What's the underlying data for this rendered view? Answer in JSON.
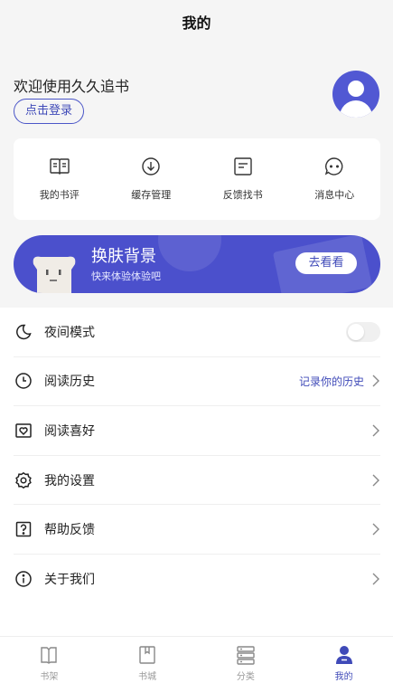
{
  "header": {
    "title": "我的"
  },
  "profile": {
    "welcome": "欢迎使用久久追书",
    "login_label": "点击登录"
  },
  "quick_actions": [
    {
      "label": "我的书评",
      "icon": "book-review-icon"
    },
    {
      "label": "缓存管理",
      "icon": "download-icon"
    },
    {
      "label": "反馈找书",
      "icon": "document-icon"
    },
    {
      "label": "消息中心",
      "icon": "message-icon"
    }
  ],
  "banner": {
    "title": "换肤背景",
    "subtitle": "快来体验体验吧",
    "button": "去看看"
  },
  "menu": [
    {
      "label": "夜间模式",
      "icon": "moon-icon",
      "toggle": false
    },
    {
      "label": "阅读历史",
      "icon": "clock-icon",
      "extra": "记录你的历史"
    },
    {
      "label": "阅读喜好",
      "icon": "heart-frame-icon"
    },
    {
      "label": "我的设置",
      "icon": "gear-icon"
    },
    {
      "label": "帮助反馈",
      "icon": "question-icon"
    },
    {
      "label": "关于我们",
      "icon": "info-icon"
    }
  ],
  "tabbar": [
    {
      "label": "书架",
      "icon": "bookshelf-icon",
      "active": false
    },
    {
      "label": "书城",
      "icon": "bookstore-icon",
      "active": false
    },
    {
      "label": "分类",
      "icon": "category-icon",
      "active": false
    },
    {
      "label": "我的",
      "icon": "profile-icon",
      "active": true
    }
  ],
  "colors": {
    "accent": "#4b50cc",
    "background": "#f5f5f5"
  }
}
